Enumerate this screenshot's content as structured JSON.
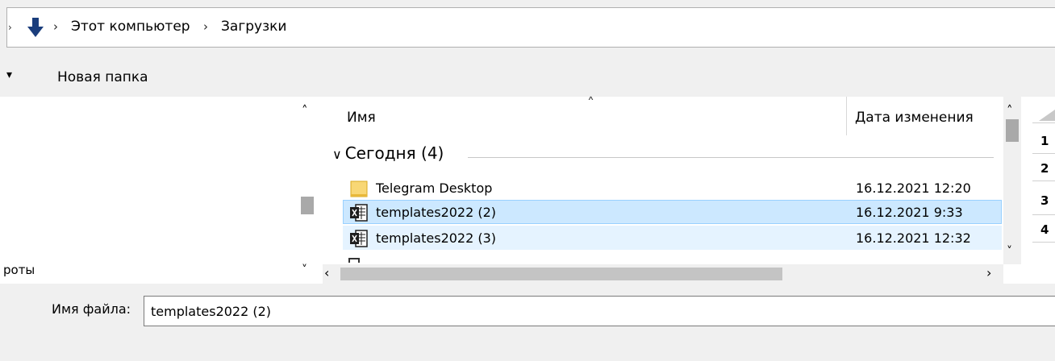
{
  "address_bar": {
    "back_glyph": "›",
    "location_icon": "download-arrow-icon",
    "sep_glyph": "›",
    "crumbs": [
      "Этот компьютер",
      "Загрузки"
    ]
  },
  "toolbar": {
    "dropdown_glyph": "▾",
    "new_folder_label": "Новая папка"
  },
  "nav_pane": {
    "partial_item": "роты",
    "scroll_up": "˄",
    "scroll_down": "˅"
  },
  "file_list": {
    "columns": {
      "name": "Имя",
      "date": "Дата изменения"
    },
    "sort_caret": "˄",
    "group": {
      "chevron": "∨",
      "label": "Сегодня (4)"
    },
    "rows": [
      {
        "name": "Telegram Desktop",
        "date": "16.12.2021 12:20",
        "icon": "folder-icon",
        "state": "normal"
      },
      {
        "name": "templates2022 (2)",
        "date": "16.12.2021 9:33",
        "icon": "excel-file-icon",
        "state": "selected"
      },
      {
        "name": "templates2022 (3)",
        "date": "16.12.2021 12:32",
        "icon": "excel-file-icon",
        "state": "hover"
      }
    ],
    "scroll_left": "‹",
    "scroll_right": "›",
    "scroll_up": "˄",
    "scroll_down": "˅"
  },
  "preview_pane": {
    "row_numbers": [
      "1",
      "2",
      "3",
      "4"
    ]
  },
  "filename_bar": {
    "label": "Имя файла:",
    "value": "templates2022 (2)"
  },
  "colors": {
    "selected_bg": "#cce8ff",
    "selected_border": "#99d1ff",
    "hover_bg": "#e5f3ff",
    "folder_yellow": "#f8d775",
    "excel_dark": "#1e1e1e",
    "download_arrow": "#1a3d7c"
  }
}
